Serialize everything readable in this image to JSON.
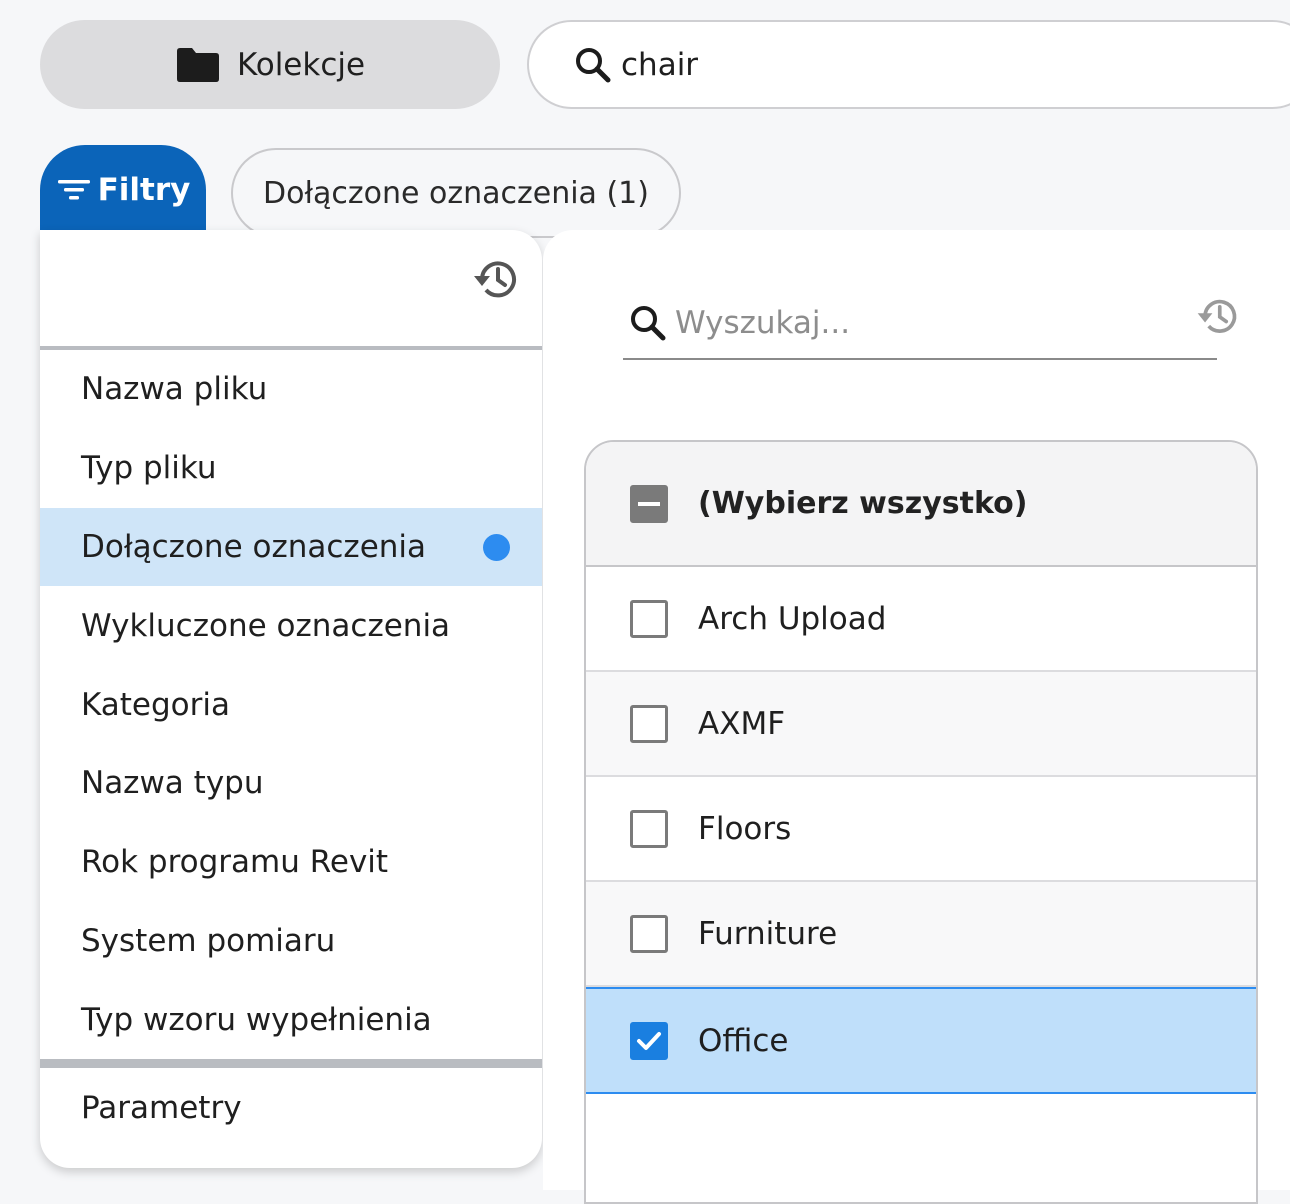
{
  "header": {
    "collections_label": "Kolekcje",
    "search_value": "chair"
  },
  "filter_bar": {
    "filters_label": "Filtry",
    "active_chip_label": "Dołączone oznaczenia (1)"
  },
  "categories": {
    "items": [
      {
        "label": "Nazwa pliku"
      },
      {
        "label": "Typ pliku"
      },
      {
        "label": "Dołączone oznaczenia",
        "active": true
      },
      {
        "label": "Wykluczone oznaczenia"
      },
      {
        "label": "Kategoria"
      },
      {
        "label": "Nazwa typu"
      },
      {
        "label": "Rok programu Revit"
      },
      {
        "label": "System pomiaru"
      },
      {
        "label": "Typ wzoru wypełnienia"
      }
    ],
    "parameters_label": "Parametry"
  },
  "values_panel": {
    "search_placeholder": "Wyszukaj...",
    "select_all_label": "(Wybierz wszystko)",
    "select_all_state": "indeterminate",
    "values": [
      {
        "label": "Arch Upload",
        "checked": false
      },
      {
        "label": "AXMF",
        "checked": false
      },
      {
        "label": "Floors",
        "checked": false
      },
      {
        "label": "Furniture",
        "checked": false
      },
      {
        "label": "Office",
        "checked": true
      }
    ]
  },
  "colors": {
    "primary": "#0b64b9",
    "active_row": "#cfe5f8",
    "selected_row": "#bfdffa",
    "checkbox_checked": "#1a7fe0",
    "dot": "#2d8cf0"
  },
  "icons": [
    "folder-icon",
    "search-icon",
    "filter-icon",
    "history-icon",
    "checkmark-icon"
  ]
}
